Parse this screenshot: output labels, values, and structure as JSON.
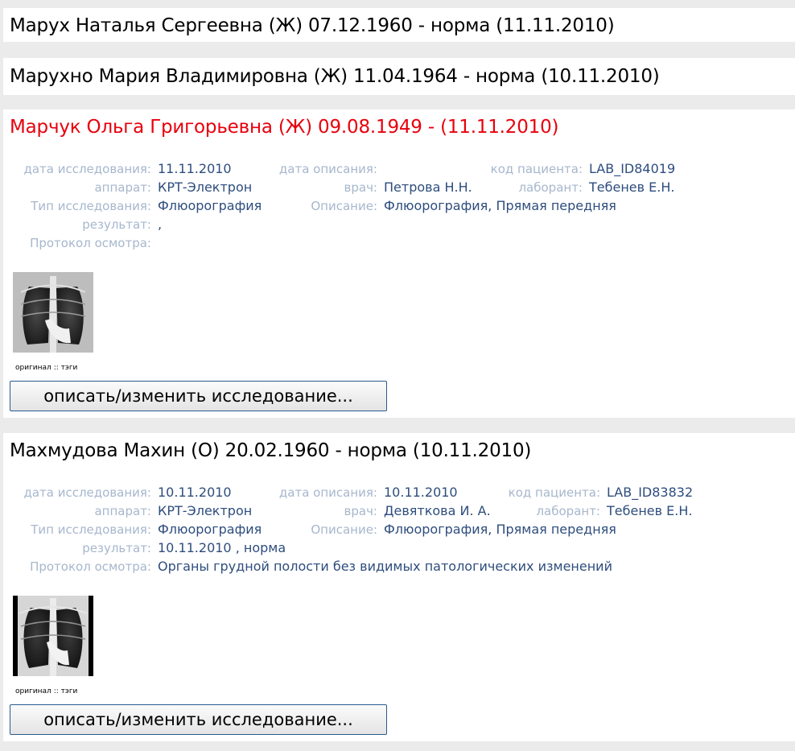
{
  "records": [
    {
      "title": "Марух Наталья Сергеевна (Ж) 07.12.1960 - норма (11.11.2010)"
    },
    {
      "title": "Марухно Мария Владимировна (Ж) 11.04.1964 - норма (10.11.2010)"
    },
    {
      "title": "Марчук Ольга Григорьевна (Ж) 09.08.1949 - (11.11.2010)",
      "title_color": "#e8000d",
      "details": {
        "study_date": "11.11.2010",
        "description_date": "",
        "patient_code": "LAB_ID84019",
        "device": "КРТ-Электрон",
        "doctor": "Петрова Н.Н.",
        "lab_assistant": "Тебенев Е.Н.",
        "study_type": "Флюорография",
        "description": "Флюорография, Прямая передняя",
        "result": ",",
        "protocol": ""
      }
    },
    {
      "title": "Махмудова Махин (О) 20.02.1960 - норма (10.11.2010)",
      "details": {
        "study_date": "10.11.2010",
        "description_date": "10.11.2010",
        "patient_code": "LAB_ID83832",
        "device": "КРТ-Электрон",
        "doctor": "Девяткова И. А.",
        "lab_assistant": "Тебенев Е.Н.",
        "study_type": "Флюорография",
        "description": "Флюорография, Прямая передняя",
        "result": "10.11.2010 , норма",
        "protocol": "Органы грудной полости без видимых патологических изменений"
      }
    }
  ],
  "labels": {
    "study_date": "дата исследования:",
    "description_date": "дата описания:",
    "patient_code": "код пациента:",
    "device": "аппарат:",
    "doctor": "врач:",
    "lab_assistant": "лаборант:",
    "study_type": "Тип исследования:",
    "description": "Описание:",
    "result": "результат:",
    "protocol": "Протокол осмотра:"
  },
  "thumb_links": {
    "original": "оригинал",
    "separator": "::",
    "tags": "тэги"
  },
  "edit_button_label": "описать/изменить исследование...",
  "colors": {
    "label": "#a7b7cd",
    "value": "#2e4d7d",
    "flagged": "#e8000d",
    "button_border": "#2a5a90"
  }
}
